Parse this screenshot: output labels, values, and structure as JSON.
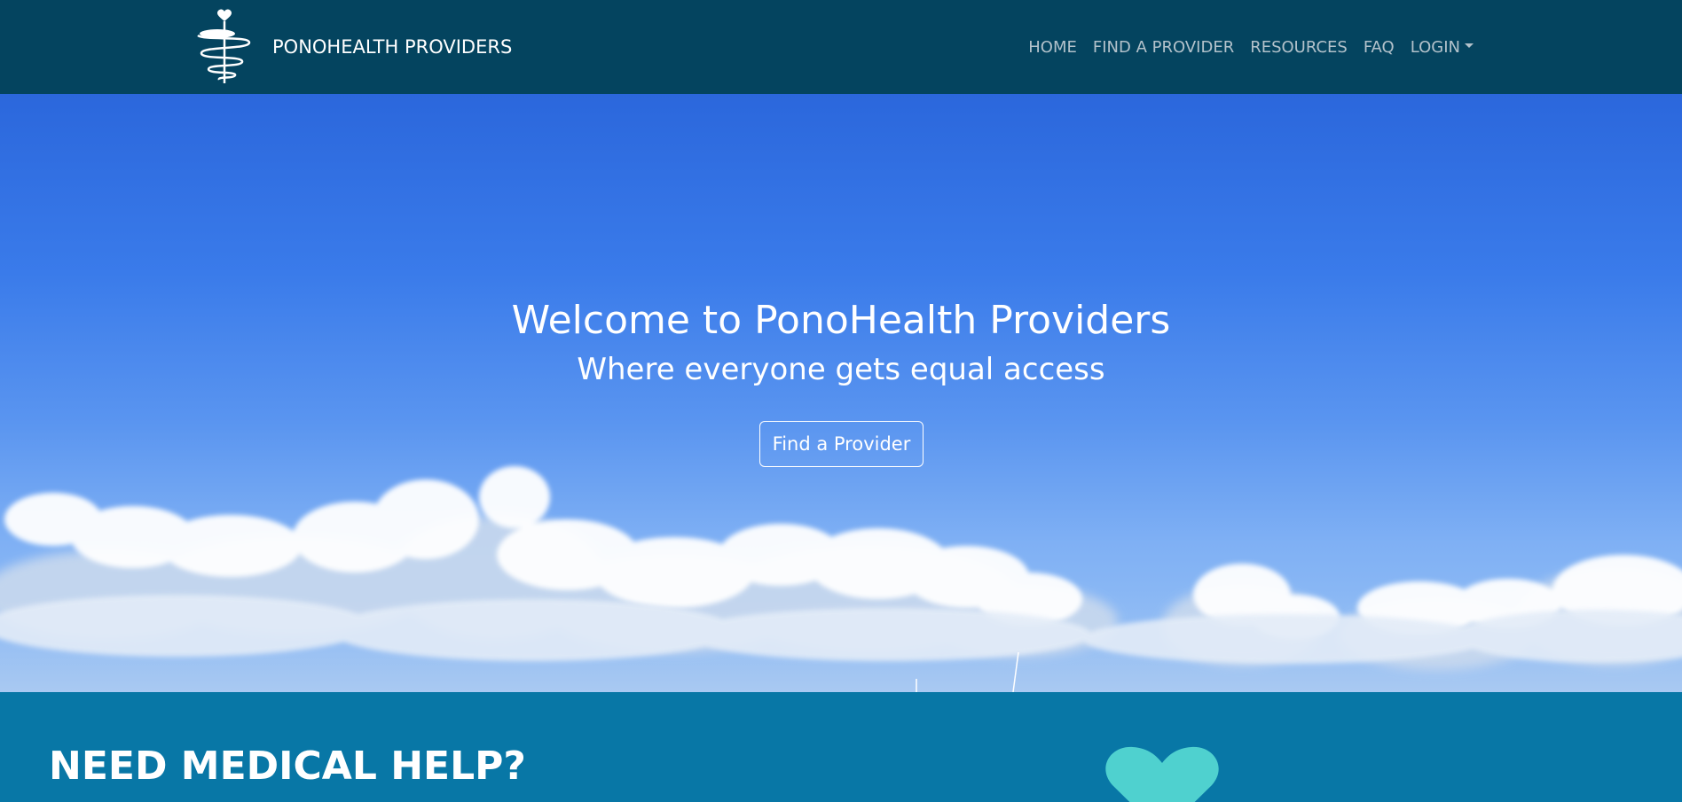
{
  "brand": {
    "name": "PONOHEALTH PROVIDERS",
    "logo_icon": "caduceus-heart-logo"
  },
  "nav": {
    "items": [
      {
        "label": "HOME"
      },
      {
        "label": "FIND A PROVIDER"
      },
      {
        "label": "RESOURCES"
      },
      {
        "label": "FAQ"
      },
      {
        "label": "LOGIN",
        "dropdown": true
      }
    ]
  },
  "hero": {
    "title": "Welcome to PonoHealth Providers",
    "subtitle": "Where everyone gets equal access",
    "button_label": "Find a Provider"
  },
  "help": {
    "title": "NEED MEDICAL HELP?",
    "icon": "heart-icon"
  },
  "colors": {
    "navbar_bg": "#04445f",
    "nav_link": "#b3c2cb",
    "help_bg": "#0877a6",
    "heart": "#4fd1cf"
  }
}
